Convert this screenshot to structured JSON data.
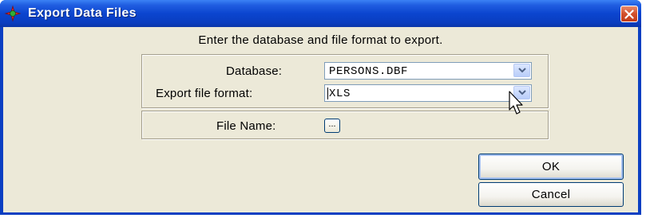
{
  "window": {
    "title": "Export Data Files",
    "title_icon": "app-star-icon",
    "close_icon": "close-icon"
  },
  "instruction": "Enter the database and file format to export.",
  "database": {
    "label": "Database:",
    "value": "PERSONS.DBF",
    "dropdown_icon": "chevron-down-icon"
  },
  "export_format": {
    "label": "Export file format:",
    "value": "XLS",
    "dropdown_icon": "chevron-down-icon"
  },
  "file_name": {
    "label": "File Name:",
    "browse_label": "..."
  },
  "buttons": {
    "ok": "OK",
    "cancel": "Cancel"
  },
  "colors": {
    "titlebar": "#0b45cf",
    "client": "#ece9d8",
    "close": "#d2502c"
  }
}
